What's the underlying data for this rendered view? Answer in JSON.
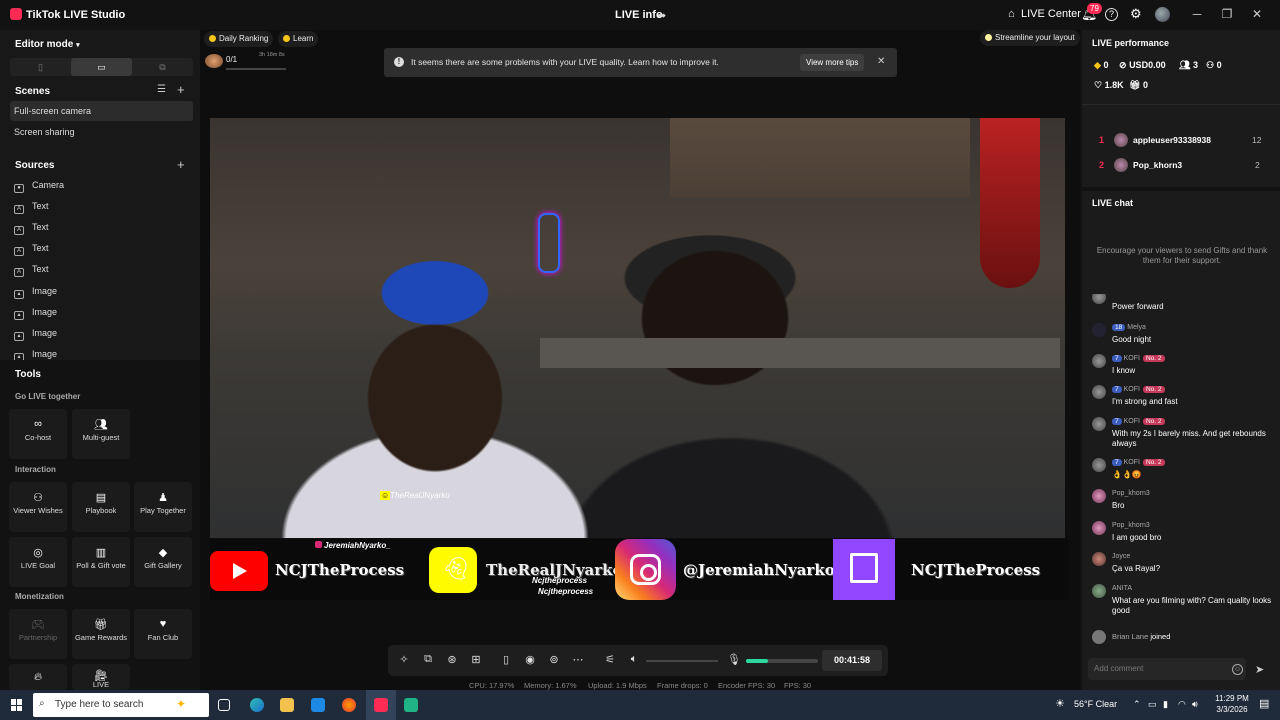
{
  "window": {
    "app_title": "TikTok LIVE Studio",
    "center_title": "LIVE info",
    "live_center": "LIVE Center",
    "notification_count": "79"
  },
  "left": {
    "editor_mode": "Editor mode",
    "scenes_heading": "Scenes",
    "scenes": [
      "Full-screen camera",
      "Screen sharing"
    ],
    "sources_heading": "Sources",
    "sources": [
      {
        "icon": "camera-icon",
        "label": "Camera"
      },
      {
        "icon": "text-icon",
        "label": "Text"
      },
      {
        "icon": "text-icon",
        "label": "Text"
      },
      {
        "icon": "text-icon",
        "label": "Text"
      },
      {
        "icon": "text-icon",
        "label": "Text"
      },
      {
        "icon": "image-icon",
        "label": "Image"
      },
      {
        "icon": "image-icon",
        "label": "Image"
      },
      {
        "icon": "image-icon",
        "label": "Image"
      },
      {
        "icon": "image-icon",
        "label": "Image"
      }
    ],
    "tools_heading": "Tools",
    "go_live_together": "Go LIVE together",
    "tool_cohost": "Co-host",
    "tool_multiguest": "Multi-guest",
    "interaction": "Interaction",
    "tool_viewer_wishes": "Viewer Wishes",
    "tool_playbook": "Playbook",
    "tool_play_together": "Play Together",
    "tool_live_goal": "LIVE Goal",
    "tool_poll_gift": "Poll & Gift vote",
    "tool_gift_gallery": "Gift Gallery",
    "monetization": "Monetization",
    "tool_partnership": "Partnership",
    "tool_game_rewards": "Game Rewards",
    "tool_fan_club": "Fan Club",
    "tool_live": "LIVE"
  },
  "center": {
    "daily_ranking": "Daily Ranking",
    "learn": "Learn",
    "streamline": "Streamline your layout",
    "progress": "0/1",
    "progress_time": "3h 18m 8s",
    "alert_text": "It seems there are some problems with your LIVE quality. Learn how to improve it.",
    "alert_button": "View more tips",
    "video_tag": "TheRealJNyarko",
    "banner": {
      "ig_handle_top": "JeremiahNyarko_",
      "yt_name": "NCJTheProcess",
      "snap_name": "TheRealJNyarko",
      "snap_sub1": "Ncjtheprocess",
      "snap_sub2": "Ncjtheprocess",
      "ig_name": "@JeremiahNyarko_",
      "tw_name": "NCJTheProcess"
    },
    "timer": "00:41:58",
    "mic_level": 0.3,
    "stats": {
      "cpu": "CPU: 17.97%",
      "memory": "Memory: 1.67%",
      "upload": "Upload: 1.9 Mbps",
      "frame_drops": "Frame drops: 0",
      "encoder_fps": "Encoder FPS: 30",
      "fps": "FPS: 30"
    }
  },
  "right": {
    "performance": "LIVE performance",
    "diamonds": "0",
    "usd": "USD0.00",
    "viewers": "3",
    "new_followers": "0",
    "likes": "1.8K",
    "gifts": "0",
    "ranking": [
      {
        "rank": "1",
        "name": "appleuser93338938",
        "value": "12"
      },
      {
        "rank": "2",
        "name": "Pop_khorn3",
        "value": "2"
      }
    ],
    "chat_heading": "LIVE chat",
    "chat_hint": "Encourage your viewers to send Gifts and thank them for their support.",
    "messages": [
      {
        "user": "",
        "level": "",
        "no2": "",
        "text": "Power forward"
      },
      {
        "user": "Melya",
        "level": "18",
        "no2": "",
        "text": "Good night"
      },
      {
        "user": "KOFI",
        "level": "7",
        "no2": "No. 2",
        "text": "I know"
      },
      {
        "user": "KOFI",
        "level": "7",
        "no2": "No. 2",
        "text": "I'm strong and fast"
      },
      {
        "user": "KOFI",
        "level": "7",
        "no2": "No. 2",
        "text": "With my 2s I barely miss. And get rebounds always"
      },
      {
        "user": "KOFI",
        "level": "7",
        "no2": "No. 2",
        "text": "👌👌😡"
      },
      {
        "user": "Pop_khorn3",
        "level": "",
        "no2": "",
        "text": "Bro"
      },
      {
        "user": "Pop_khorn3",
        "level": "",
        "no2": "",
        "text": "I am good bro"
      },
      {
        "user": "Joyce",
        "level": "",
        "no2": "",
        "text": "Ça va Rayal?"
      },
      {
        "user": "ANITA",
        "level": "",
        "no2": "",
        "text": "What are you filming with? Cam quality looks good"
      }
    ],
    "joined_user": "Brian Lane",
    "joined_text": "joined",
    "add_comment": "Add comment"
  },
  "taskbar": {
    "search_placeholder": "Type here to search",
    "weather": "56°F  Clear",
    "time": "11:29 PM",
    "date": "3/3/2026"
  }
}
